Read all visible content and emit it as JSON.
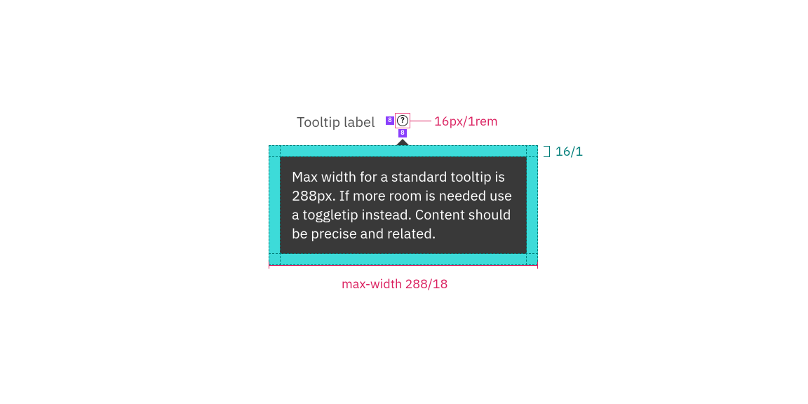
{
  "label": {
    "text": "Tooltip label",
    "gap_horizontal": "8",
    "gap_vertical": "8",
    "icon_size_label": "16px/1rem"
  },
  "tooltip": {
    "body": "Max width for a standard tooltip is 288px. If more room is needed use a toggletip instead. Content should be precise and related."
  },
  "measurements": {
    "padding_top_label": "16/1",
    "max_width_label": "max-width 288/18"
  },
  "colors": {
    "magenta": "#da1e5e",
    "purple": "#8a3ffc",
    "teal": "#3ddbd9",
    "teal_dark": "#007d79",
    "gray_body": "#393939",
    "gray_text": "#525252"
  }
}
